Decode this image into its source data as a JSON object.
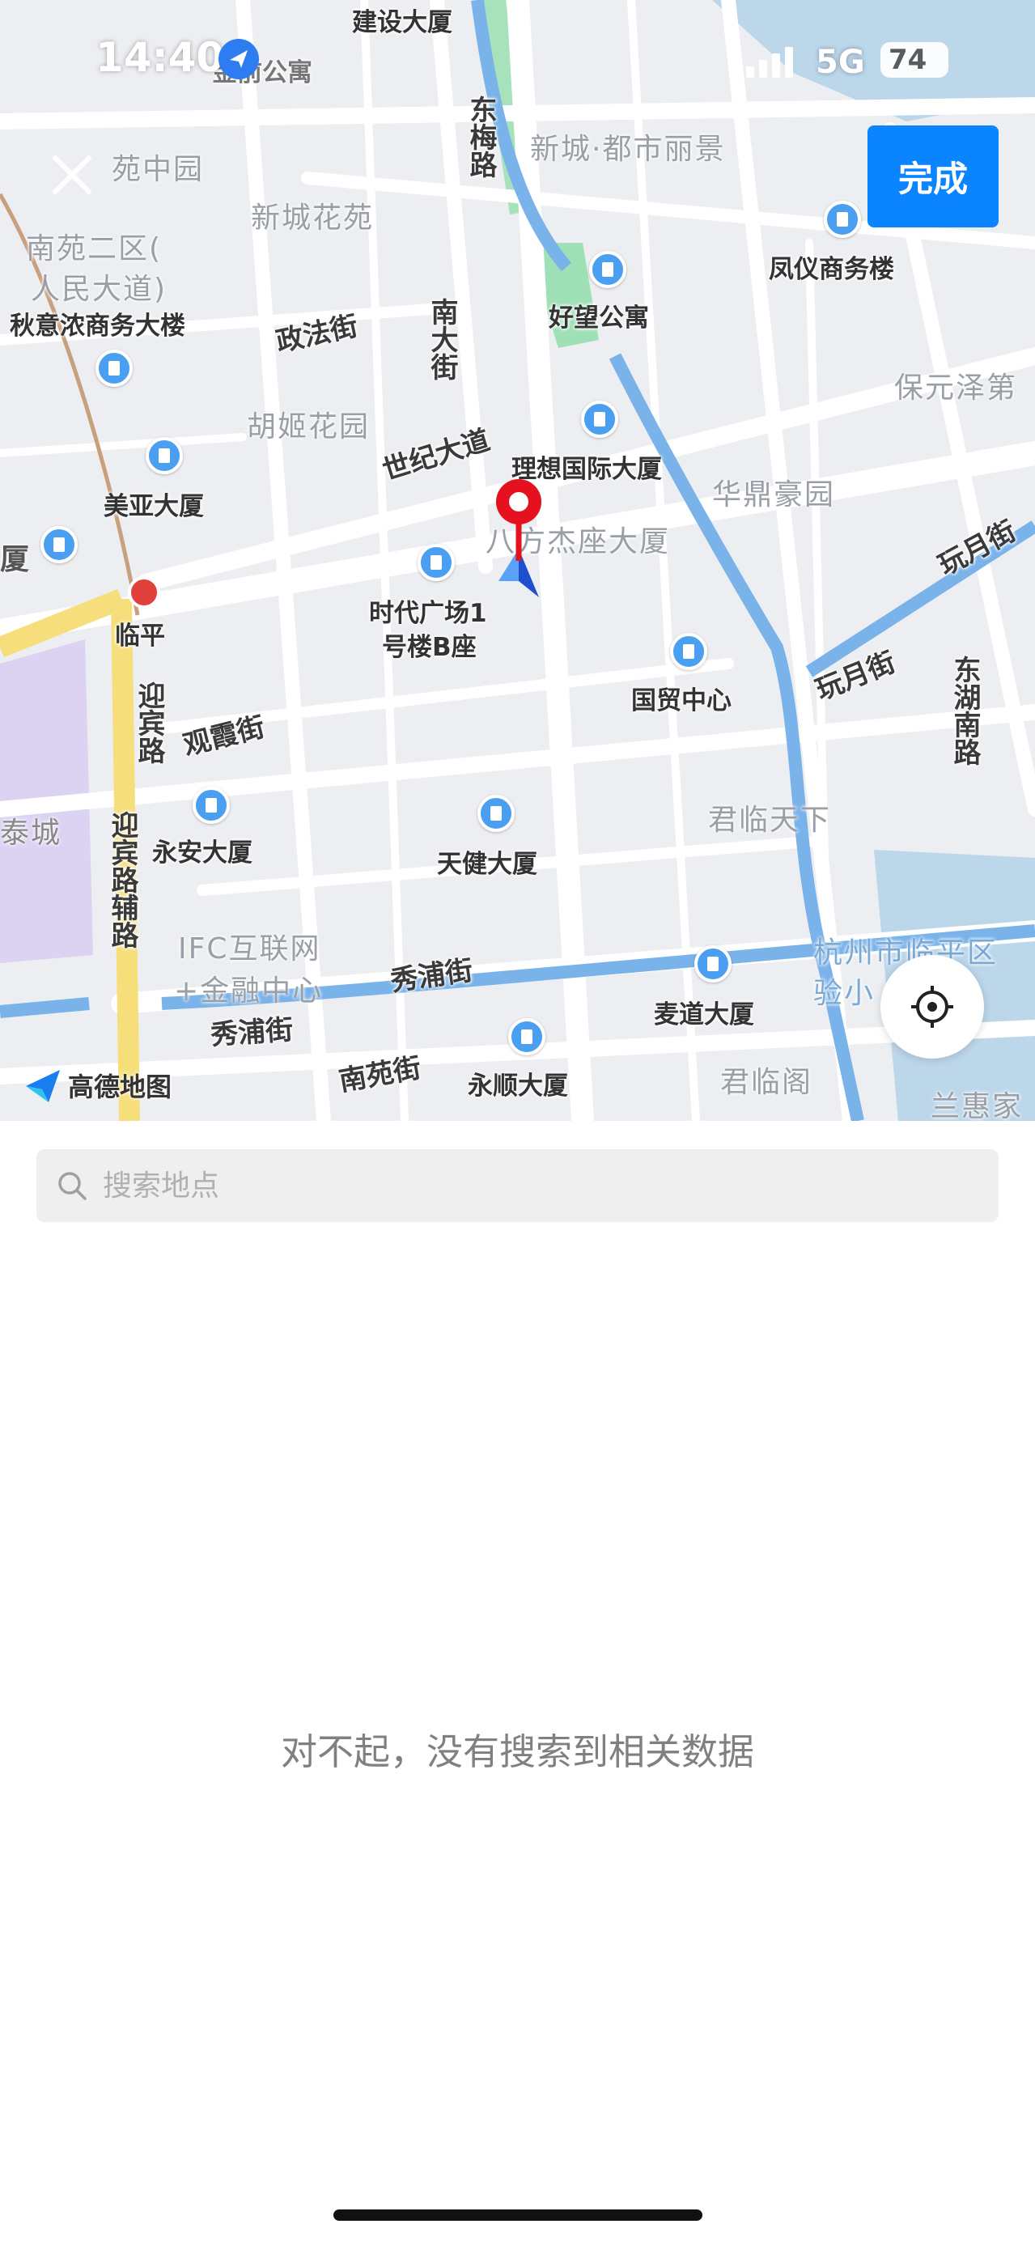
{
  "status_bar": {
    "time": "14:40",
    "network": "5G",
    "battery": "74"
  },
  "header": {
    "done_label": "完成"
  },
  "map": {
    "logo_text": "高德地图",
    "pois": [
      {
        "label": "建设大厦"
      },
      {
        "label": "金前公寓"
      },
      {
        "label": "凤仪商务楼"
      },
      {
        "label": "好望公寓"
      },
      {
        "label": "秋意浓商务大楼"
      },
      {
        "label": "理想国际大厦"
      },
      {
        "label": "美亚大厦"
      },
      {
        "label": "时代广场1"
      },
      {
        "label": "号楼B座"
      },
      {
        "label": "国贸中心"
      },
      {
        "label": "永安大厦"
      },
      {
        "label": "天健大厦"
      },
      {
        "label": "麦道大厦"
      },
      {
        "label": "永顺大厦"
      },
      {
        "label": "临平"
      }
    ],
    "areas": [
      {
        "label": "苑中园"
      },
      {
        "label": "新城花苑"
      },
      {
        "label": "南苑二区("
      },
      {
        "label": "人民大道)"
      },
      {
        "label": "新城·都市丽景"
      },
      {
        "label": "胡姬花园"
      },
      {
        "label": "华鼎豪园"
      },
      {
        "label": "八方杰座大厦"
      },
      {
        "label": "保元泽第"
      },
      {
        "label": "君临天下"
      },
      {
        "label": "IFC互联网"
      },
      {
        "label": "+金融中心"
      },
      {
        "label": "杭州市临平区"
      },
      {
        "label": "验小"
      },
      {
        "label": "君临阁"
      },
      {
        "label": "兰惠家"
      },
      {
        "label": "泰城"
      },
      {
        "label": "厦"
      }
    ],
    "roads": [
      {
        "label": "东梅路"
      },
      {
        "label": "南大街"
      },
      {
        "label": "政法街"
      },
      {
        "label": "世纪大道"
      },
      {
        "label": "迎宾路"
      },
      {
        "label": "观霞街"
      },
      {
        "label": "迎宾路辅路"
      },
      {
        "label": "秀浦街"
      },
      {
        "label": "南苑街"
      },
      {
        "label": "玩月街"
      },
      {
        "label": "东湖南路"
      }
    ]
  },
  "search": {
    "placeholder": "搜索地点"
  },
  "empty_message": "对不起，没有搜索到相关数据"
}
